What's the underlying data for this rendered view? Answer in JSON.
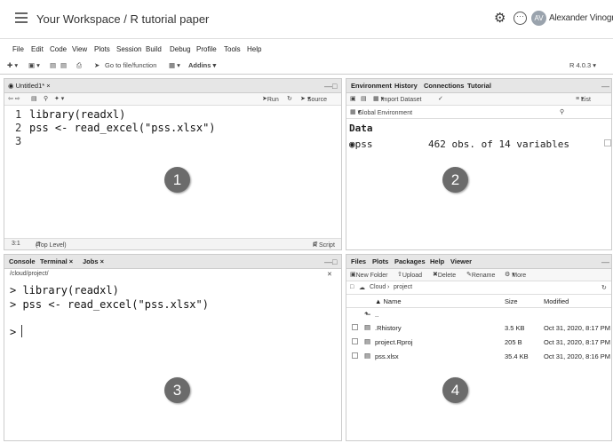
{
  "header": {
    "title": "Your Workspace / R tutorial paper",
    "user_initials": "AV",
    "user_name": "Alexander Vinogradov"
  },
  "menu": [
    "File",
    "Edit",
    "Code",
    "View",
    "Plots",
    "Session",
    "Build",
    "Debug",
    "Profile",
    "Tools",
    "Help"
  ],
  "toolbar": {
    "goto_placeholder": "Go to file/function",
    "addins_label": "Addins",
    "r_version": "R 4.0.3"
  },
  "editor": {
    "tab_label": "Untitled1*",
    "run_label": "Run",
    "source_label": "Source",
    "lines": [
      "library(readxl)",
      "pss <- read_excel(\"pss.xlsx\")",
      ""
    ],
    "line_numbers": [
      "1",
      "2",
      "3"
    ],
    "status_pos": "3:1",
    "status_scope": "(Top Level)",
    "status_type": "R Script",
    "badge": "1"
  },
  "environment": {
    "tabs": [
      "Environment",
      "History",
      "Connections",
      "Tutorial"
    ],
    "import_label": "Import Dataset",
    "list_label": "List",
    "scope_label": "Global Environment",
    "section_label": "Data",
    "rows": [
      {
        "name": "pss",
        "value": "462 obs. of 14 variables"
      }
    ],
    "badge": "2"
  },
  "console": {
    "tabs": [
      "Console",
      "Terminal",
      "Jobs"
    ],
    "path": "/cloud/project/",
    "lines": [
      "> library(readxl)",
      "> pss <- read_excel(\"pss.xlsx\")"
    ],
    "prompt": ">",
    "badge": "3"
  },
  "files": {
    "tabs": [
      "Files",
      "Plots",
      "Packages",
      "Help",
      "Viewer"
    ],
    "actions": [
      "New Folder",
      "Upload",
      "Delete",
      "Rename",
      "More"
    ],
    "breadcrumb_root": "Cloud",
    "breadcrumb_dir": "project",
    "columns": [
      "Name",
      "Size",
      "Modified"
    ],
    "up_label": "..",
    "rows": [
      {
        "name": ".Rhistory",
        "size": "3.5 KB",
        "modified": "Oct 31, 2020, 8:17 PM"
      },
      {
        "name": "project.Rproj",
        "size": "205 B",
        "modified": "Oct 31, 2020, 8:17 PM"
      },
      {
        "name": "pss.xlsx",
        "size": "35.4 KB",
        "modified": "Oct 31, 2020, 8:16 PM"
      }
    ],
    "badge": "4"
  }
}
